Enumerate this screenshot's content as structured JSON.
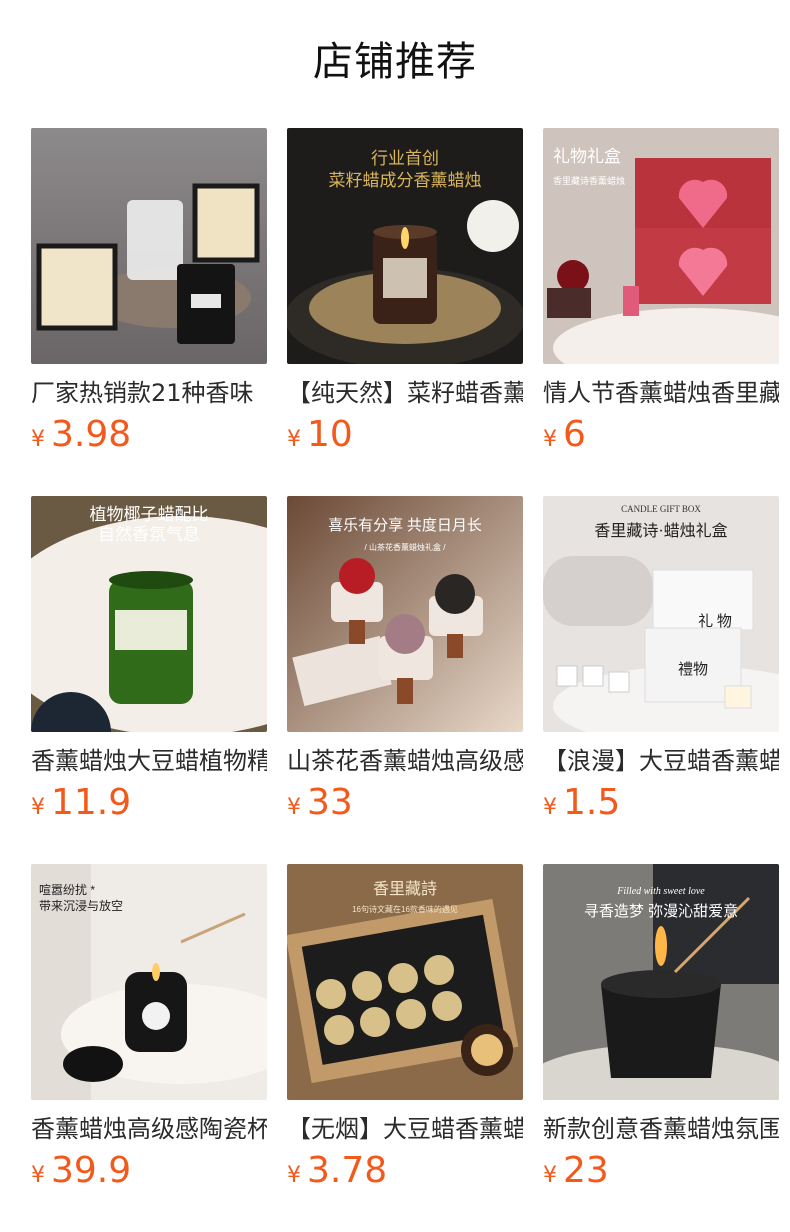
{
  "section_title": "店铺推荐",
  "currency": "¥",
  "products": [
    {
      "name": "厂家热销款21种香味",
      "price": "3.98",
      "image_text": []
    },
    {
      "name": "【纯天然】菜籽蜡香薰",
      "price": "10",
      "image_text": [
        "行业首创",
        "菜籽蜡成分香薰蜡烛"
      ]
    },
    {
      "name": "情人节香薰蜡烛香里藏",
      "price": "6",
      "image_text": [
        "礼物礼盒",
        "香里藏诗香薰蜡烛"
      ]
    },
    {
      "name": "香薰蜡烛大豆蜡植物精",
      "price": "11.9",
      "image_text": [
        "植物椰子蜡配比",
        "自然香氛气息"
      ]
    },
    {
      "name": "山茶花香薰蜡烛高级感",
      "price": "33",
      "image_text": [
        "喜乐有分享 共度日月长",
        "/ 山茶花香薰蜡烛礼盒 /"
      ]
    },
    {
      "name": "【浪漫】大豆蜡香薰蜡",
      "price": "1.5",
      "image_text": [
        "CANDLE GIFT BOX",
        "香里藏诗·蜡烛礼盒",
        "礼 物",
        "禮物"
      ]
    },
    {
      "name": "香薰蜡烛高级感陶瓷杯",
      "price": "39.9",
      "image_text": [
        "喧嚣纷扰 *",
        "带来沉浸与放空"
      ]
    },
    {
      "name": "【无烟】大豆蜡香薰蜡",
      "price": "3.78",
      "image_text": [
        "香里藏詩",
        "16句诗文藏在16款香味的遇见"
      ]
    },
    {
      "name": "新款创意香薰蜡烛氛围",
      "price": "23",
      "image_text": [
        "Filled with sweet love",
        "寻香造梦 弥漫沁甜爱意"
      ]
    }
  ]
}
